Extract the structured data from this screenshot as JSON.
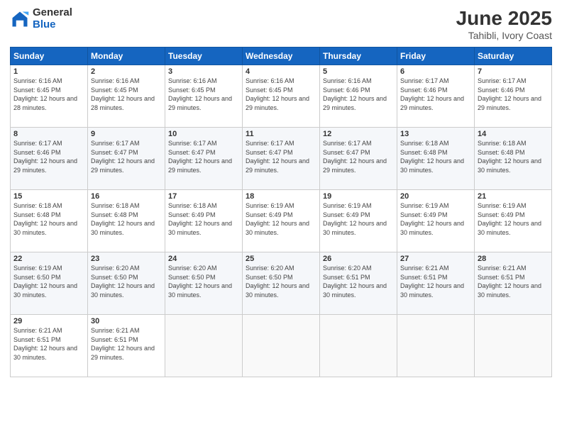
{
  "logo": {
    "general": "General",
    "blue": "Blue"
  },
  "header": {
    "month_year": "June 2025",
    "location": "Tahibli, Ivory Coast"
  },
  "days_of_week": [
    "Sunday",
    "Monday",
    "Tuesday",
    "Wednesday",
    "Thursday",
    "Friday",
    "Saturday"
  ],
  "weeks": [
    [
      {
        "date": "1",
        "sunrise": "Sunrise: 6:16 AM",
        "sunset": "Sunset: 6:45 PM",
        "daylight": "Daylight: 12 hours and 28 minutes."
      },
      {
        "date": "2",
        "sunrise": "Sunrise: 6:16 AM",
        "sunset": "Sunset: 6:45 PM",
        "daylight": "Daylight: 12 hours and 28 minutes."
      },
      {
        "date": "3",
        "sunrise": "Sunrise: 6:16 AM",
        "sunset": "Sunset: 6:45 PM",
        "daylight": "Daylight: 12 hours and 29 minutes."
      },
      {
        "date": "4",
        "sunrise": "Sunrise: 6:16 AM",
        "sunset": "Sunset: 6:45 PM",
        "daylight": "Daylight: 12 hours and 29 minutes."
      },
      {
        "date": "5",
        "sunrise": "Sunrise: 6:16 AM",
        "sunset": "Sunset: 6:46 PM",
        "daylight": "Daylight: 12 hours and 29 minutes."
      },
      {
        "date": "6",
        "sunrise": "Sunrise: 6:17 AM",
        "sunset": "Sunset: 6:46 PM",
        "daylight": "Daylight: 12 hours and 29 minutes."
      },
      {
        "date": "7",
        "sunrise": "Sunrise: 6:17 AM",
        "sunset": "Sunset: 6:46 PM",
        "daylight": "Daylight: 12 hours and 29 minutes."
      }
    ],
    [
      {
        "date": "8",
        "sunrise": "Sunrise: 6:17 AM",
        "sunset": "Sunset: 6:46 PM",
        "daylight": "Daylight: 12 hours and 29 minutes."
      },
      {
        "date": "9",
        "sunrise": "Sunrise: 6:17 AM",
        "sunset": "Sunset: 6:47 PM",
        "daylight": "Daylight: 12 hours and 29 minutes."
      },
      {
        "date": "10",
        "sunrise": "Sunrise: 6:17 AM",
        "sunset": "Sunset: 6:47 PM",
        "daylight": "Daylight: 12 hours and 29 minutes."
      },
      {
        "date": "11",
        "sunrise": "Sunrise: 6:17 AM",
        "sunset": "Sunset: 6:47 PM",
        "daylight": "Daylight: 12 hours and 29 minutes."
      },
      {
        "date": "12",
        "sunrise": "Sunrise: 6:17 AM",
        "sunset": "Sunset: 6:47 PM",
        "daylight": "Daylight: 12 hours and 29 minutes."
      },
      {
        "date": "13",
        "sunrise": "Sunrise: 6:18 AM",
        "sunset": "Sunset: 6:48 PM",
        "daylight": "Daylight: 12 hours and 30 minutes."
      },
      {
        "date": "14",
        "sunrise": "Sunrise: 6:18 AM",
        "sunset": "Sunset: 6:48 PM",
        "daylight": "Daylight: 12 hours and 30 minutes."
      }
    ],
    [
      {
        "date": "15",
        "sunrise": "Sunrise: 6:18 AM",
        "sunset": "Sunset: 6:48 PM",
        "daylight": "Daylight: 12 hours and 30 minutes."
      },
      {
        "date": "16",
        "sunrise": "Sunrise: 6:18 AM",
        "sunset": "Sunset: 6:48 PM",
        "daylight": "Daylight: 12 hours and 30 minutes."
      },
      {
        "date": "17",
        "sunrise": "Sunrise: 6:18 AM",
        "sunset": "Sunset: 6:49 PM",
        "daylight": "Daylight: 12 hours and 30 minutes."
      },
      {
        "date": "18",
        "sunrise": "Sunrise: 6:19 AM",
        "sunset": "Sunset: 6:49 PM",
        "daylight": "Daylight: 12 hours and 30 minutes."
      },
      {
        "date": "19",
        "sunrise": "Sunrise: 6:19 AM",
        "sunset": "Sunset: 6:49 PM",
        "daylight": "Daylight: 12 hours and 30 minutes."
      },
      {
        "date": "20",
        "sunrise": "Sunrise: 6:19 AM",
        "sunset": "Sunset: 6:49 PM",
        "daylight": "Daylight: 12 hours and 30 minutes."
      },
      {
        "date": "21",
        "sunrise": "Sunrise: 6:19 AM",
        "sunset": "Sunset: 6:49 PM",
        "daylight": "Daylight: 12 hours and 30 minutes."
      }
    ],
    [
      {
        "date": "22",
        "sunrise": "Sunrise: 6:19 AM",
        "sunset": "Sunset: 6:50 PM",
        "daylight": "Daylight: 12 hours and 30 minutes."
      },
      {
        "date": "23",
        "sunrise": "Sunrise: 6:20 AM",
        "sunset": "Sunset: 6:50 PM",
        "daylight": "Daylight: 12 hours and 30 minutes."
      },
      {
        "date": "24",
        "sunrise": "Sunrise: 6:20 AM",
        "sunset": "Sunset: 6:50 PM",
        "daylight": "Daylight: 12 hours and 30 minutes."
      },
      {
        "date": "25",
        "sunrise": "Sunrise: 6:20 AM",
        "sunset": "Sunset: 6:50 PM",
        "daylight": "Daylight: 12 hours and 30 minutes."
      },
      {
        "date": "26",
        "sunrise": "Sunrise: 6:20 AM",
        "sunset": "Sunset: 6:51 PM",
        "daylight": "Daylight: 12 hours and 30 minutes."
      },
      {
        "date": "27",
        "sunrise": "Sunrise: 6:21 AM",
        "sunset": "Sunset: 6:51 PM",
        "daylight": "Daylight: 12 hours and 30 minutes."
      },
      {
        "date": "28",
        "sunrise": "Sunrise: 6:21 AM",
        "sunset": "Sunset: 6:51 PM",
        "daylight": "Daylight: 12 hours and 30 minutes."
      }
    ],
    [
      {
        "date": "29",
        "sunrise": "Sunrise: 6:21 AM",
        "sunset": "Sunset: 6:51 PM",
        "daylight": "Daylight: 12 hours and 30 minutes."
      },
      {
        "date": "30",
        "sunrise": "Sunrise: 6:21 AM",
        "sunset": "Sunset: 6:51 PM",
        "daylight": "Daylight: 12 hours and 29 minutes."
      },
      {
        "date": "",
        "sunrise": "",
        "sunset": "",
        "daylight": ""
      },
      {
        "date": "",
        "sunrise": "",
        "sunset": "",
        "daylight": ""
      },
      {
        "date": "",
        "sunrise": "",
        "sunset": "",
        "daylight": ""
      },
      {
        "date": "",
        "sunrise": "",
        "sunset": "",
        "daylight": ""
      },
      {
        "date": "",
        "sunrise": "",
        "sunset": "",
        "daylight": ""
      }
    ]
  ]
}
